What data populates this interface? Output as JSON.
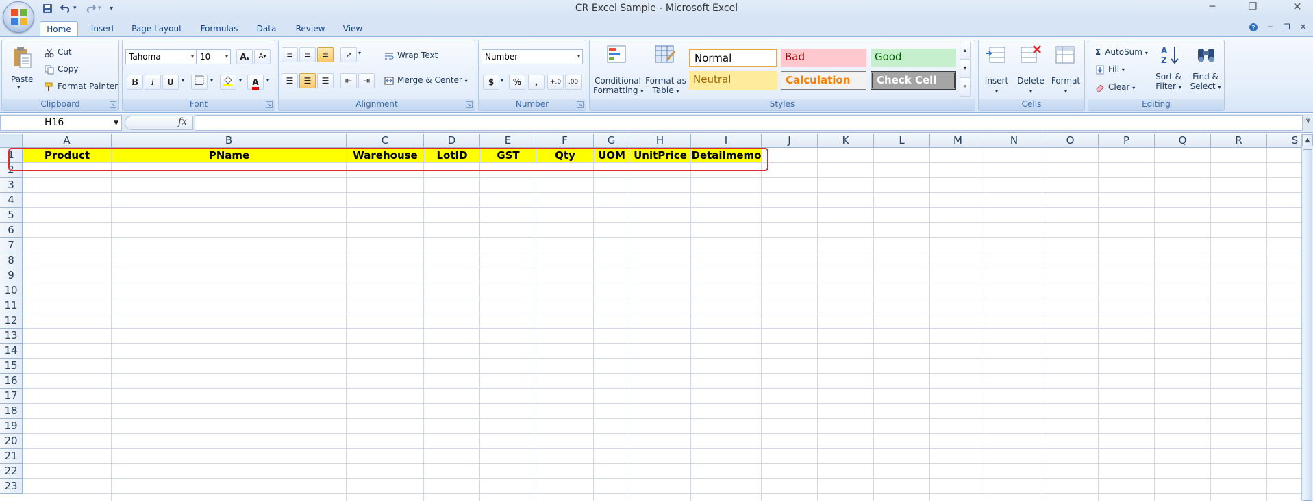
{
  "app": {
    "title": "CR Excel Sample - Microsoft Excel"
  },
  "qat": {
    "customize": "▾"
  },
  "tabs": [
    "Home",
    "Insert",
    "Page Layout",
    "Formulas",
    "Data",
    "Review",
    "View"
  ],
  "ribbon": {
    "clipboard": {
      "label": "Clipboard",
      "paste": "Paste",
      "cut": "Cut",
      "copy": "Copy",
      "format_painter": "Format Painter"
    },
    "font": {
      "label": "Font",
      "font_name": "Tahoma",
      "font_size": "10",
      "bold": "B",
      "italic": "I",
      "underline": "U"
    },
    "alignment": {
      "label": "Alignment",
      "wrap_text": "Wrap Text",
      "merge_center": "Merge & Center"
    },
    "number": {
      "label": "Number",
      "format": "Number",
      "currency": "$",
      "percent": "%",
      "comma": ","
    },
    "styles": {
      "label": "Styles",
      "conditional_formatting_1": "Conditional",
      "conditional_formatting_2": "Formatting",
      "format_as_table_1": "Format as",
      "format_as_table_2": "Table",
      "cells": [
        {
          "name": "Normal",
          "bg": "#ffffff",
          "fg": "#000000"
        },
        {
          "name": "Bad",
          "bg": "#ffc7ce",
          "fg": "#9c0006"
        },
        {
          "name": "Good",
          "bg": "#c6efce",
          "fg": "#006100"
        },
        {
          "name": "Neutral",
          "bg": "#ffeb9c",
          "fg": "#9c6500"
        },
        {
          "name": "Calculation",
          "bg": "#f2f2f2",
          "fg": "#fa7d00"
        },
        {
          "name": "Check Cell",
          "bg": "#a5a5a5",
          "fg": "#ffffff"
        }
      ]
    },
    "cells": {
      "label": "Cells",
      "insert": "Insert",
      "delete": "Delete",
      "format": "Format"
    },
    "editing": {
      "label": "Editing",
      "autosum": "AutoSum",
      "fill": "Fill",
      "clear": "Clear",
      "sort_filter_1": "Sort &",
      "sort_filter_2": "Filter",
      "find_select_1": "Find &",
      "find_select_2": "Select"
    }
  },
  "formula_bar": {
    "name_box": "H16",
    "fx": "fx",
    "value": ""
  },
  "grid": {
    "columns": [
      "A",
      "B",
      "C",
      "D",
      "E",
      "F",
      "G",
      "H",
      "I",
      "J",
      "K",
      "L",
      "M",
      "N",
      "O",
      "P",
      "Q",
      "R",
      "S"
    ],
    "rows": [
      "1",
      "2",
      "3",
      "4",
      "5",
      "6",
      "7",
      "8",
      "9",
      "10",
      "11",
      "12",
      "13",
      "14",
      "15",
      "16",
      "17",
      "18",
      "19",
      "20",
      "21",
      "22",
      "23"
    ],
    "header_row": [
      "Product",
      "PName",
      "Warehouse",
      "LotID",
      "GST",
      "Qty",
      "UOM",
      "UnitPrice",
      "Detailmemo"
    ],
    "header_fill": "#ffff00",
    "highlight_color": "#e0282e"
  }
}
